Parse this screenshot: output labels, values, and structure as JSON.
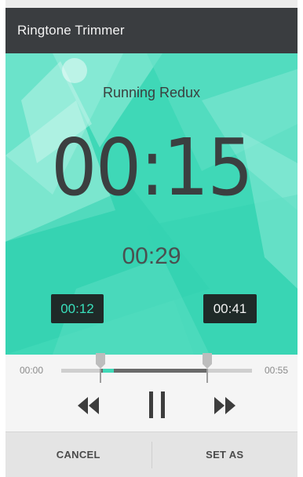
{
  "app": {
    "title": "Ringtone Trimmer"
  },
  "player": {
    "song_title": "Running Redux",
    "elapsed": "00:15",
    "duration": "00:29",
    "trim_start": "00:12",
    "trim_end": "00:41"
  },
  "timeline": {
    "start_label": "00:00",
    "end_label": "00:55"
  },
  "icons": {
    "rewind": "rewind-icon",
    "pause": "pause-icon",
    "forward": "fast-forward-icon"
  },
  "actions": {
    "cancel_label": "CANCEL",
    "set_as_label": "SET AS"
  },
  "colors": {
    "accent": "#3fd8b7",
    "titlebar": "#3a3d40",
    "badge": "#1f2a28"
  }
}
